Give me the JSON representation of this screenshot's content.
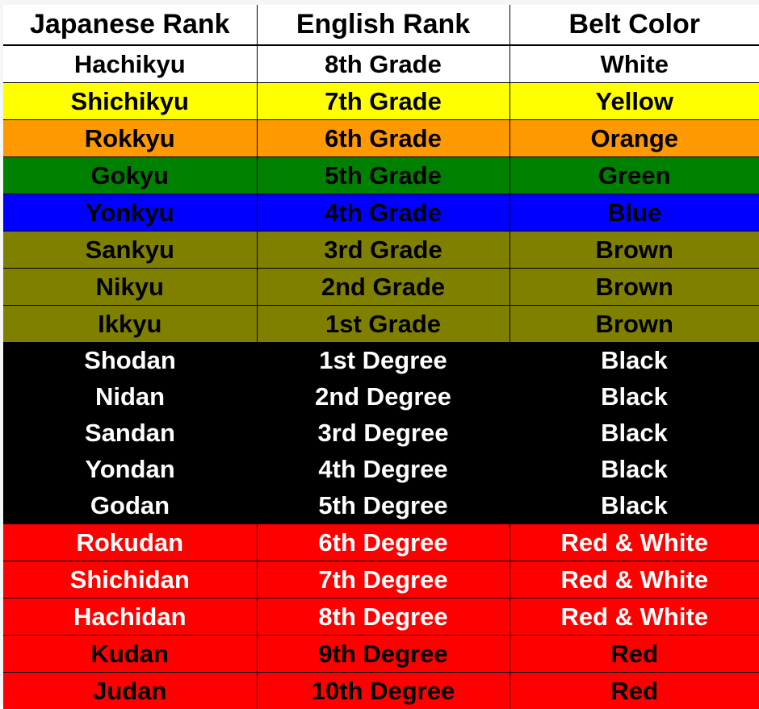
{
  "table": {
    "headers": {
      "japanese": "Japanese Rank",
      "english": "English Rank",
      "belt": "Belt Color"
    },
    "rows": [
      {
        "japanese": "Hachikyu",
        "english": "8th Grade",
        "belt": "White",
        "bg": "#ffffff",
        "fg": "#000000"
      },
      {
        "japanese": "Shichikyu",
        "english": "7th Grade",
        "belt": "Yellow",
        "bg": "#ffff00",
        "fg": "#000000"
      },
      {
        "japanese": "Rokkyu",
        "english": "6th Grade",
        "belt": "Orange",
        "bg": "#ff9900",
        "fg": "#000000"
      },
      {
        "japanese": "Gokyu",
        "english": "5th Grade",
        "belt": "Green",
        "bg": "#008000",
        "fg": "#000000"
      },
      {
        "japanese": "Yonkyu",
        "english": "4th Grade",
        "belt": "Blue",
        "bg": "#0000ff",
        "fg": "#000000"
      },
      {
        "japanese": "Sankyu",
        "english": "3rd Grade",
        "belt": "Brown",
        "bg": "#808000",
        "fg": "#000000"
      },
      {
        "japanese": "Nikyu",
        "english": "2nd Grade",
        "belt": "Brown",
        "bg": "#808000",
        "fg": "#000000"
      },
      {
        "japanese": "Ikkyu",
        "english": "1st Grade",
        "belt": "Brown",
        "bg": "#808000",
        "fg": "#000000"
      },
      {
        "japanese": "Shodan",
        "english": "1st Degree",
        "belt": "Black",
        "bg": "#000000",
        "fg": "#ffffff"
      },
      {
        "japanese": "Nidan",
        "english": "2nd Degree",
        "belt": "Black",
        "bg": "#000000",
        "fg": "#ffffff"
      },
      {
        "japanese": "Sandan",
        "english": "3rd Degree",
        "belt": "Black",
        "bg": "#000000",
        "fg": "#ffffff"
      },
      {
        "japanese": "Yondan",
        "english": "4th Degree",
        "belt": "Black",
        "bg": "#000000",
        "fg": "#ffffff"
      },
      {
        "japanese": "Godan",
        "english": "5th Degree",
        "belt": "Black",
        "bg": "#000000",
        "fg": "#ffffff"
      },
      {
        "japanese": "Rokudan",
        "english": "6th Degree",
        "belt": "Red & White",
        "bg": "#ff0000",
        "fg": "#ffffff"
      },
      {
        "japanese": "Shichidan",
        "english": "7th Degree",
        "belt": "Red & White",
        "bg": "#ff0000",
        "fg": "#ffffff"
      },
      {
        "japanese": "Hachidan",
        "english": "8th Degree",
        "belt": "Red & White",
        "bg": "#ff0000",
        "fg": "#ffffff"
      },
      {
        "japanese": "Kudan",
        "english": "9th Degree",
        "belt": "Red",
        "bg": "#ff0000",
        "fg": "#000000"
      },
      {
        "japanese": "Judan",
        "english": "10th Degree",
        "belt": "Red",
        "bg": "#ff0000",
        "fg": "#000000"
      }
    ]
  }
}
